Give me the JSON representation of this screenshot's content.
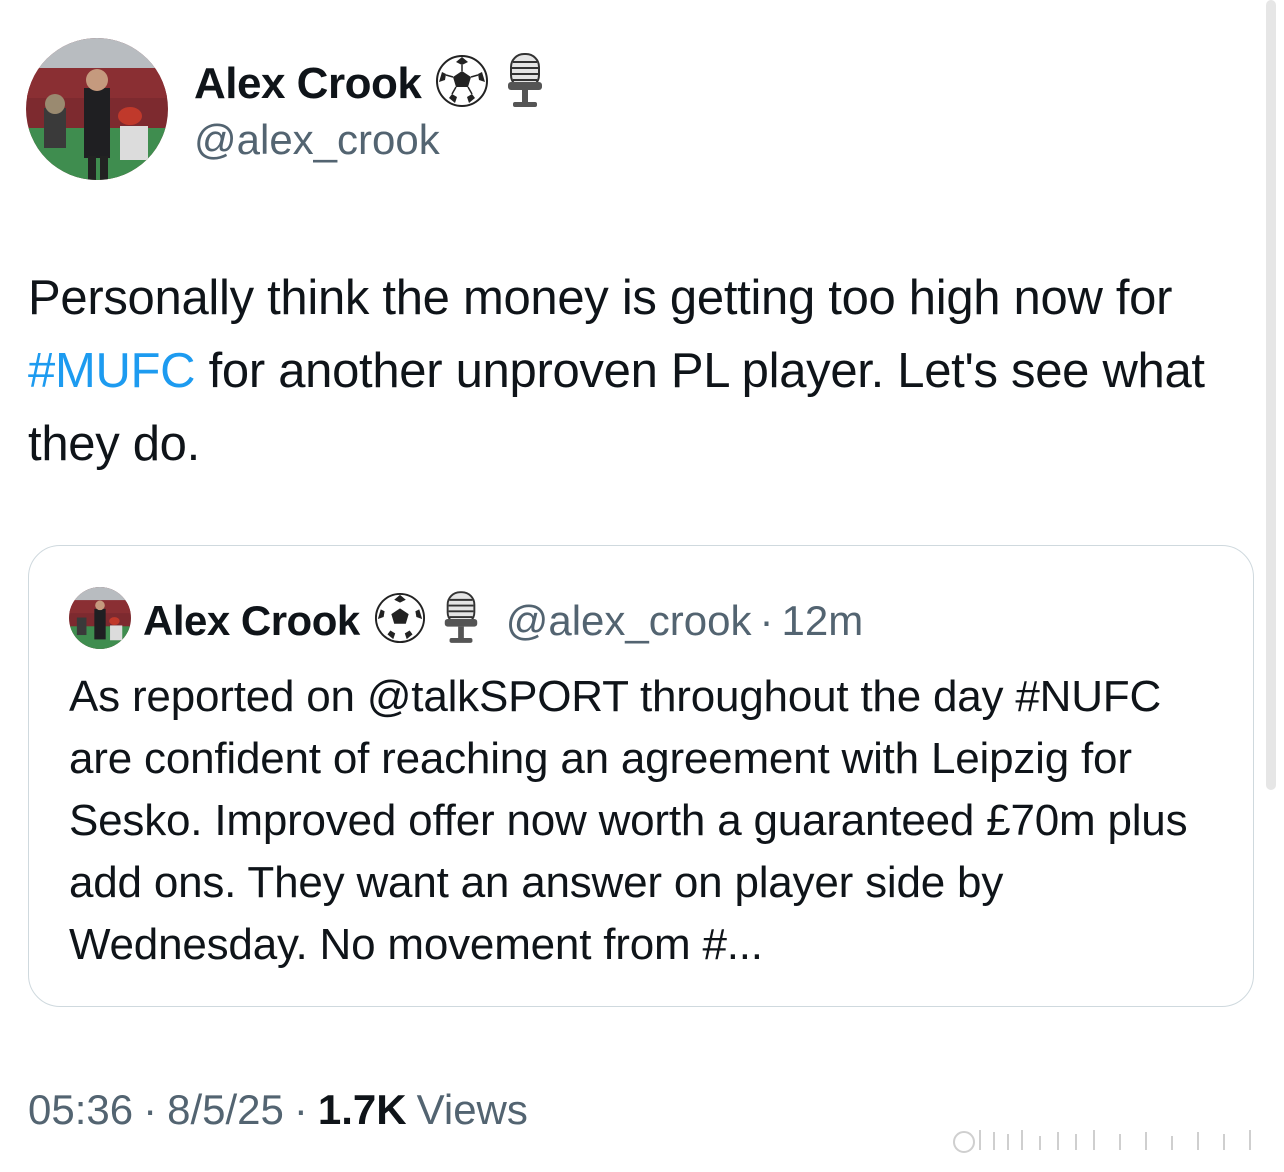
{
  "tweet": {
    "author": {
      "display_name": "Alex Crook",
      "handle": "@alex_crook",
      "badges": [
        "soccer-ball-icon",
        "microphone-icon"
      ]
    },
    "text": {
      "part1": "Personally think the money is getting too high now for ",
      "hashtag": "#MUFC",
      "part2": " for another unproven PL player. Let's see what they do."
    },
    "quoted": {
      "display_name": "Alex Crook",
      "handle": "@alex_crook",
      "separator": "·",
      "time": "12m",
      "text": "As reported on @talkSPORT throughout the day #NUFC are confident of reaching an agreement with Leipzig for Sesko. Improved offer now worth a guaranteed £70m plus add ons. They want an answer on player side by Wednesday. No movement from #..."
    },
    "meta": {
      "time": "05:36",
      "separator": "·",
      "date": "8/5/25",
      "views_count": "1.7K",
      "views_label": "Views"
    }
  },
  "colors": {
    "text": "#0f1419",
    "secondary": "#536471",
    "link": "#1d9bf0",
    "border": "#cfd9de"
  }
}
